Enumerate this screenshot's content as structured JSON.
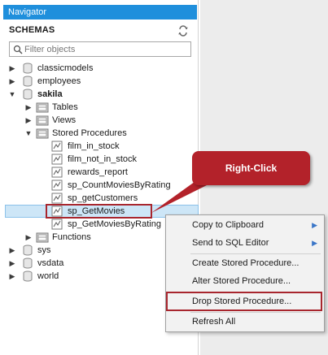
{
  "navigator": {
    "header": "Navigator",
    "schemas_title": "SCHEMAS",
    "filter_placeholder": "Filter objects",
    "tree": {
      "schemas": [
        {
          "name": "classicmodels"
        },
        {
          "name": "employees"
        },
        {
          "name": "sakila"
        },
        {
          "name": "sys"
        },
        {
          "name": "vsdata"
        },
        {
          "name": "world"
        }
      ],
      "sakila_children": {
        "tables": "Tables",
        "views": "Views",
        "stored_procedures": "Stored Procedures",
        "functions": "Functions"
      },
      "procedures": [
        "film_in_stock",
        "film_not_in_stock",
        "rewards_report",
        "sp_CountMoviesByRating",
        "sp_getCustomers",
        "sp_GetMovies",
        "sp_GetMoviesByRating"
      ]
    }
  },
  "callout": {
    "text": "Right-Click",
    "color": "#b3222a"
  },
  "context_menu": {
    "items": [
      {
        "label": "Copy to Clipboard",
        "submenu": true
      },
      {
        "label": "Send to SQL Editor",
        "submenu": true
      },
      {
        "label": "Create Stored Procedure...",
        "submenu": false
      },
      {
        "label": "Alter Stored Procedure...",
        "submenu": false
      },
      {
        "label": "Drop Stored Procedure...",
        "submenu": false
      },
      {
        "label": "Refresh All",
        "submenu": false
      }
    ]
  },
  "colors": {
    "header_blue": "#1f8fdc",
    "selection": "#cde6f7",
    "highlight_red": "#a8262e"
  }
}
